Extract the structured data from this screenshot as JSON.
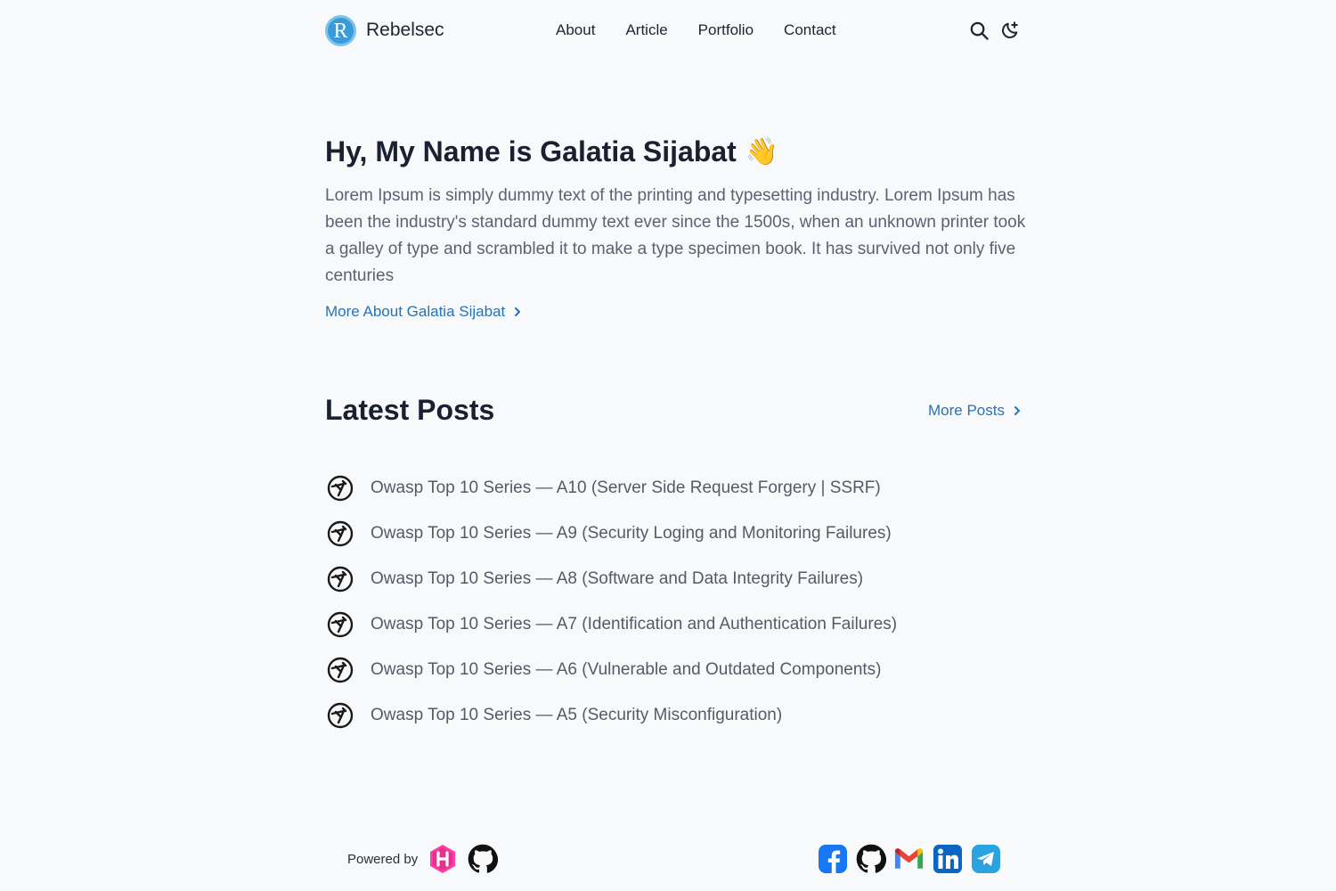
{
  "header": {
    "logo_letter": "R",
    "brand": "Rebelsec",
    "nav": [
      "About",
      "Article",
      "Portfolio",
      "Contact"
    ],
    "icons": [
      "search-icon",
      "theme-toggle-icon"
    ]
  },
  "hero": {
    "title": "Hy, My Name is Galatia Sijabat",
    "emoji": "👋",
    "bio": "Lorem Ipsum is simply dummy text of the printing and typesetting industry. Lorem Ipsum has been the industry's standard dummy text ever since the 1500s, when an unknown printer took a galley of type and scrambled it to make a type specimen book. It has survived not only five centuries",
    "more_link": "More About Galatia Sijabat"
  },
  "posts": {
    "heading": "Latest Posts",
    "more_link": "More Posts",
    "items": [
      "Owasp Top 10 Series — A10 (Server Side Request Forgery | SSRF)",
      "Owasp Top 10 Series — A9 (Security Loging and Monitoring Failures)",
      "Owasp Top 10 Series — A8 (Software and Data Integrity Failures)",
      "Owasp Top 10 Series — A7 (Identification and Authentication Failures)",
      "Owasp Top 10 Series — A6 (Vulnerable and Outdated Components)",
      "Owasp Top 10 Series — A5 (Security Misconfiguration)"
    ]
  },
  "footer": {
    "powered_by": "Powered by",
    "powered_icons": [
      "hugo-icon",
      "github-icon"
    ],
    "social_icons": [
      "facebook-icon",
      "github-icon",
      "gmail-icon",
      "linkedin-icon",
      "telegram-icon"
    ]
  },
  "colors": {
    "background": "#f8f9fb",
    "link": "#2673b8",
    "text": "#1f2430",
    "muted": "#5b6272"
  }
}
